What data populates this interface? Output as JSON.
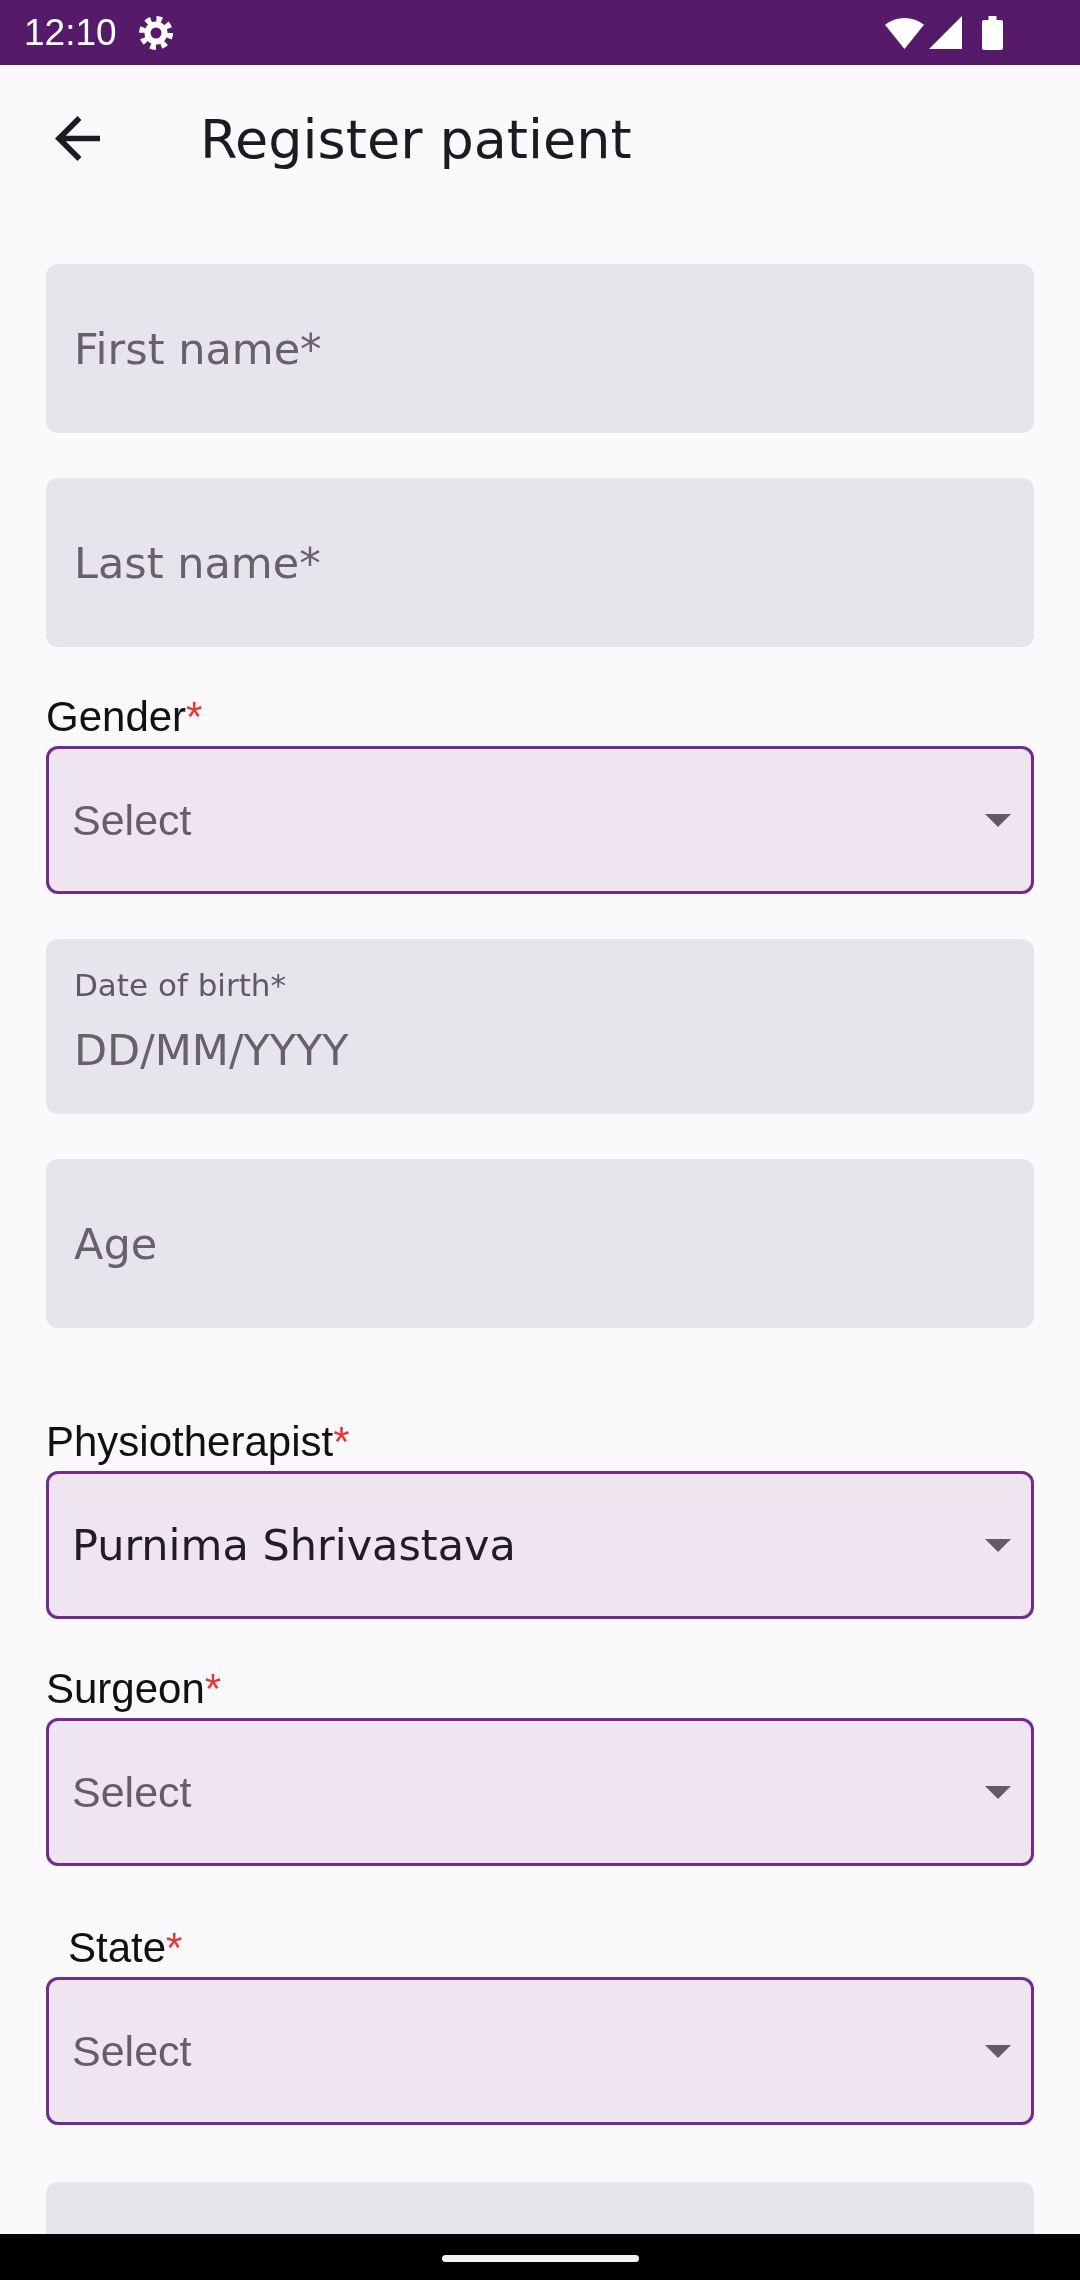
{
  "status_bar": {
    "time": "12:10"
  },
  "app_bar": {
    "title": "Register patient"
  },
  "fields": [
    {
      "kind": "text",
      "placeholder": "First name*"
    },
    {
      "kind": "text",
      "placeholder": "Last name*"
    },
    {
      "kind": "dropdown",
      "label": "Gender",
      "required_mark": "*",
      "placeholder": "Select"
    },
    {
      "kind": "text",
      "label": "Date of birth*",
      "placeholder": "DD/MM/YYYY"
    },
    {
      "kind": "text",
      "placeholder": "Age"
    },
    {
      "kind": "dropdown",
      "label": "Physiotherapist",
      "required_mark": "*",
      "value": "Purnima Shrivastava"
    },
    {
      "kind": "dropdown",
      "label": "Surgeon",
      "required_mark": "*",
      "placeholder": "Select"
    },
    {
      "kind": "dropdown",
      "label": "State",
      "required_mark": "*",
      "placeholder": "Select"
    },
    {
      "kind": "text"
    }
  ]
}
